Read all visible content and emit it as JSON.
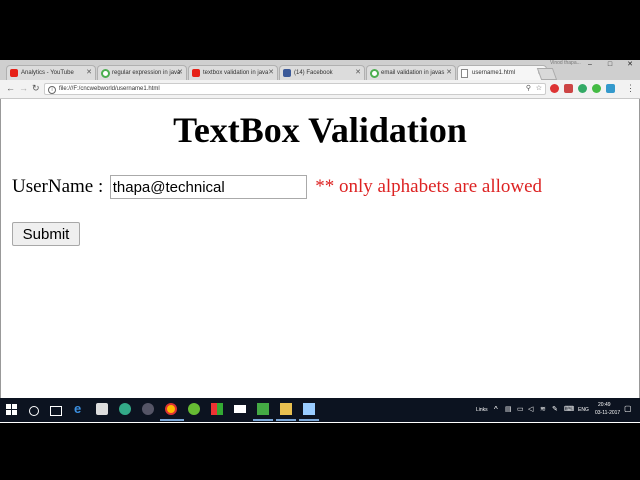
{
  "browser": {
    "window_title": "Vinod thapa...",
    "tabs": [
      {
        "label": "Analytics - YouTube",
        "icon": "youtube-icon",
        "color": "#e62117"
      },
      {
        "label": "regular expression in java",
        "icon": "chrome-icon",
        "color": "#4caf50"
      },
      {
        "label": "textbox validation in java",
        "icon": "youtube-icon",
        "color": "#e62117"
      },
      {
        "label": "(14) Facebook",
        "icon": "facebook-icon",
        "color": "#3b5998"
      },
      {
        "label": "email validation in javas",
        "icon": "chrome-icon",
        "color": "#4caf50"
      },
      {
        "label": "username1.html",
        "icon": "file-icon",
        "color": "#888888"
      }
    ],
    "url": "file:///F:/cncwebworld/username1.html"
  },
  "page": {
    "heading": "TextBox Validation",
    "username_label": "UserName :",
    "username_value": "thapa@technical",
    "error_message": "** only alphabets are allowed",
    "submit_label": "Submit"
  },
  "taskbar": {
    "links_label": "Links",
    "language": "ENG",
    "time": "20:49",
    "date": "03-11-2017"
  }
}
